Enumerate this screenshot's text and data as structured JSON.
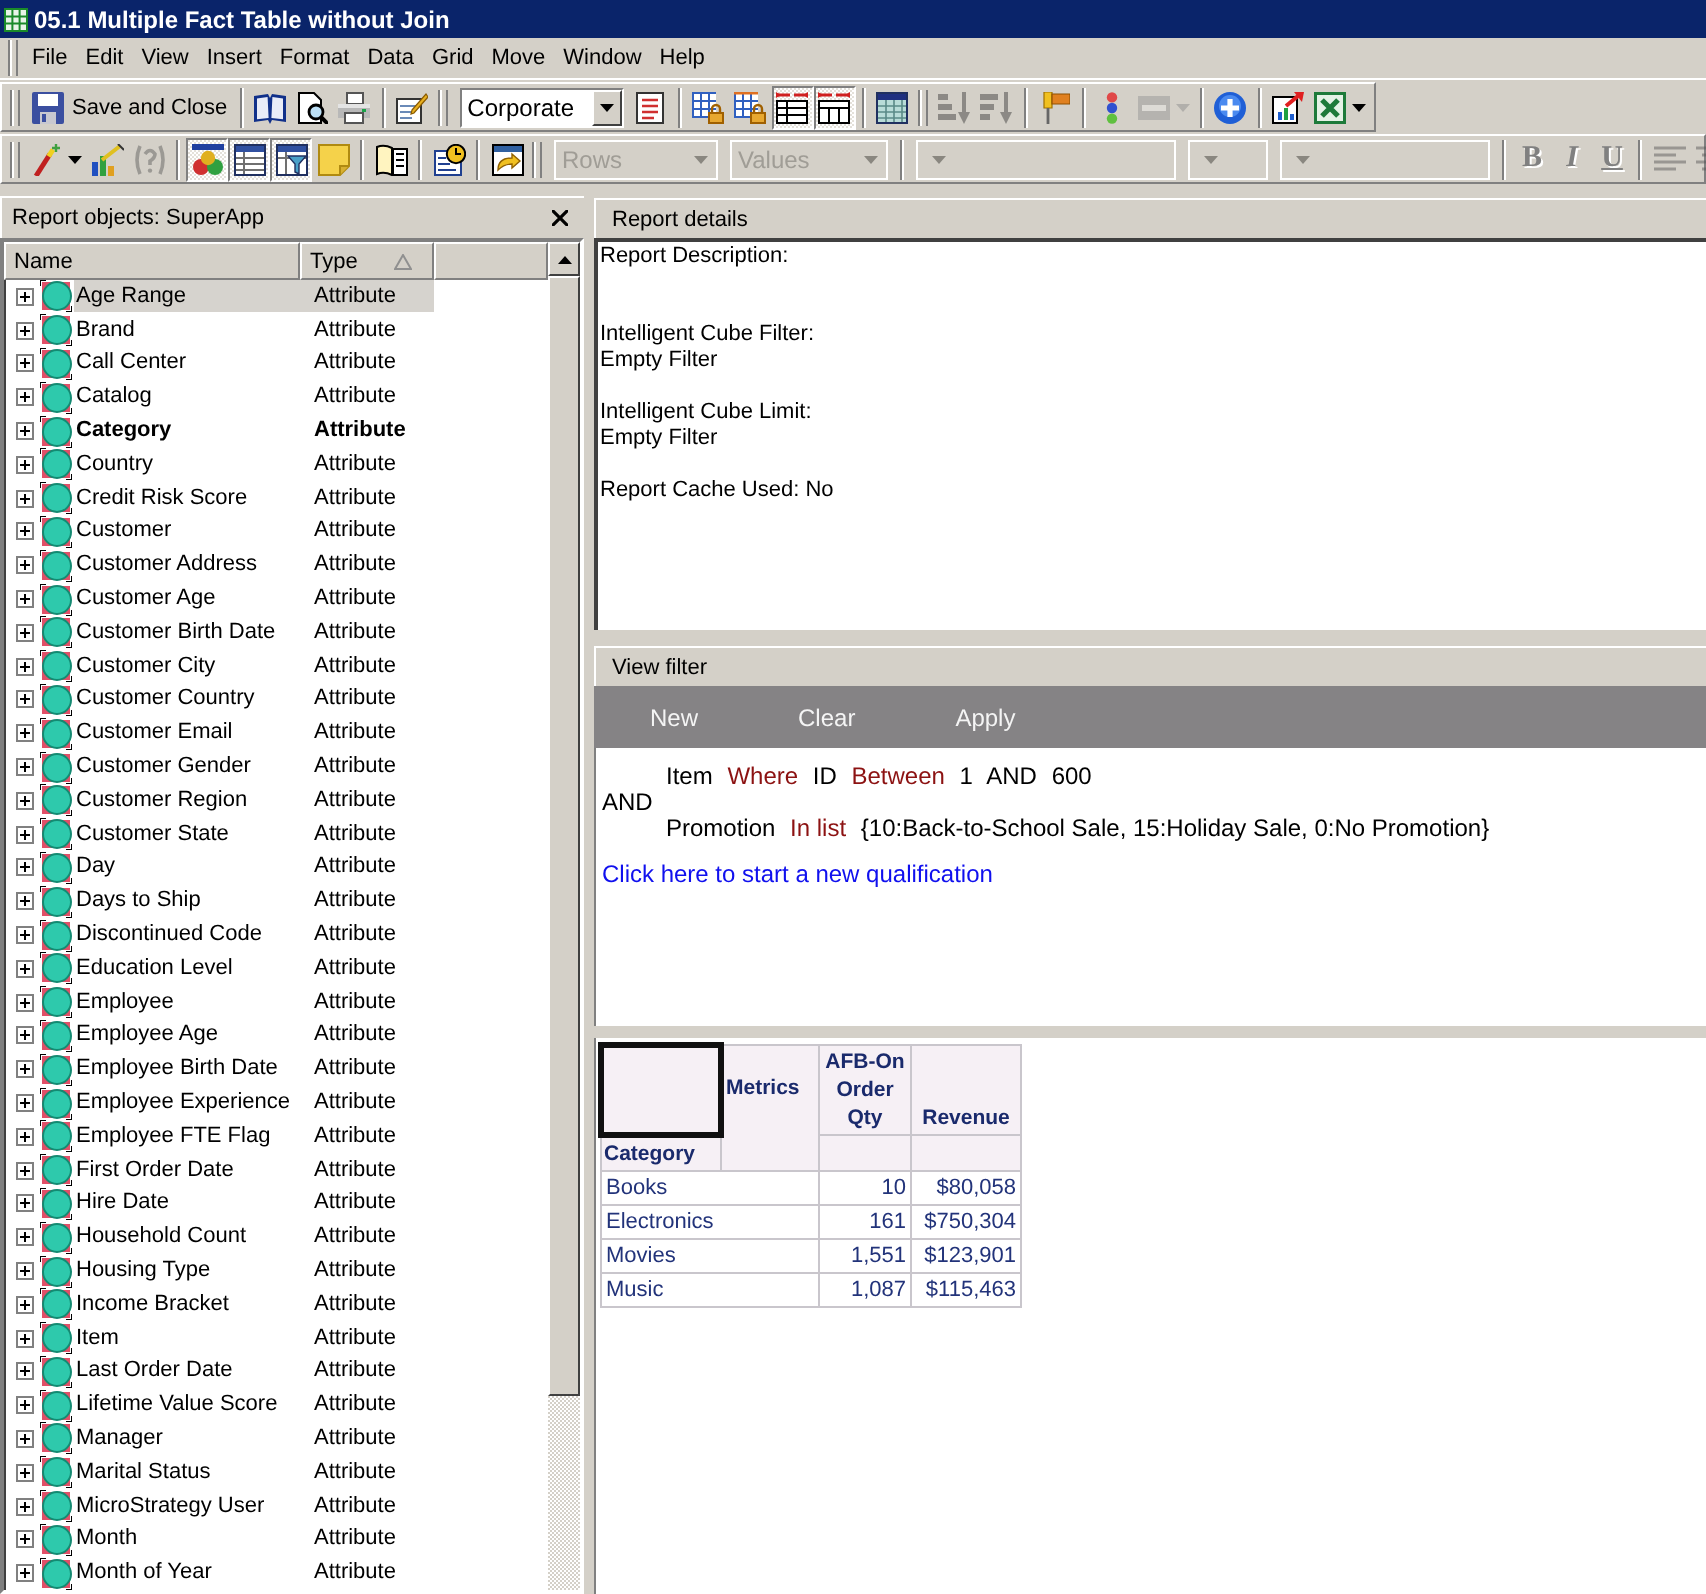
{
  "window": {
    "title": "05.1 Multiple Fact Table without Join"
  },
  "menu": [
    "File",
    "Edit",
    "View",
    "Insert",
    "Format",
    "Data",
    "Grid",
    "Move",
    "Window",
    "Help"
  ],
  "toolbar_1": {
    "save_button": {
      "label": "Save and Close"
    },
    "style_dropdown": {
      "value": "Corporate"
    },
    "buttons": [
      {
        "pressed": false,
        "disabled": false
      },
      {
        "pressed": false,
        "disabled": false
      },
      {
        "pressed": false,
        "disabled": false
      },
      {
        "pressed": false,
        "disabled": false
      },
      {
        "pressed": false,
        "disabled": false
      },
      {
        "pressed": false,
        "disabled": false
      },
      {
        "pressed": false,
        "disabled": false
      },
      {
        "pressed": true,
        "disabled": false
      },
      {
        "pressed": true,
        "disabled": false
      },
      {
        "pressed": false,
        "disabled": false
      },
      {
        "pressed": false,
        "disabled": true
      },
      {
        "pressed": false,
        "disabled": true
      },
      {
        "pressed": false,
        "disabled": false
      },
      {
        "pressed": false,
        "disabled": false
      },
      {
        "pressed": false,
        "disabled": true
      },
      {
        "pressed": false,
        "disabled": false
      },
      {
        "pressed": false,
        "disabled": false
      },
      {
        "pressed": false,
        "disabled": false
      }
    ]
  },
  "toolbar_2": {
    "buttons": [
      {
        "pressed": false,
        "disabled": false
      },
      {
        "pressed": false,
        "disabled": false
      },
      {
        "pressed": false,
        "disabled": true
      },
      {
        "pressed": true,
        "disabled": false
      },
      {
        "pressed": true,
        "disabled": false
      },
      {
        "pressed": true,
        "disabled": false
      },
      {
        "pressed": false,
        "disabled": false
      },
      {
        "pressed": false,
        "disabled": false
      },
      {
        "pressed": false,
        "disabled": false
      },
      {
        "pressed": false,
        "disabled": false
      },
      {
        "pressed": false,
        "disabled": true
      },
      {
        "pressed": false,
        "disabled": true
      }
    ],
    "pivot_dropdowns": [
      {
        "value": "Rows",
        "disabled": true
      },
      {
        "value": "Values",
        "disabled": true
      }
    ],
    "format_dropdowns": [
      {
        "disabled": true
      },
      {
        "disabled": true
      },
      {
        "disabled": true
      }
    ],
    "text_style_buttons": [
      {
        "label": "B",
        "kind": "bold",
        "disabled": true
      },
      {
        "label": "I",
        "kind": "italic",
        "disabled": true
      },
      {
        "label": "U",
        "kind": "underline",
        "disabled": true
      }
    ]
  },
  "report_objects": {
    "title": "Report objects: SuperApp",
    "columns": [
      {
        "label": "Name",
        "sorted": false
      },
      {
        "label": "Type",
        "sorted": true
      }
    ],
    "rows": [
      {
        "name": "Age Range",
        "type": "Attribute",
        "selected": true,
        "in_report": false,
        "expanded": false
      },
      {
        "name": "Brand",
        "type": "Attribute",
        "selected": false,
        "in_report": false,
        "expanded": false
      },
      {
        "name": "Call Center",
        "type": "Attribute",
        "selected": false,
        "in_report": false,
        "expanded": false
      },
      {
        "name": "Catalog",
        "type": "Attribute",
        "selected": false,
        "in_report": false,
        "expanded": false
      },
      {
        "name": "Category",
        "type": "Attribute",
        "selected": false,
        "in_report": true,
        "expanded": false
      },
      {
        "name": "Country",
        "type": "Attribute",
        "selected": false,
        "in_report": false,
        "expanded": false
      },
      {
        "name": "Credit Risk Score",
        "type": "Attribute",
        "selected": false,
        "in_report": false,
        "expanded": false
      },
      {
        "name": "Customer",
        "type": "Attribute",
        "selected": false,
        "in_report": false,
        "expanded": false
      },
      {
        "name": "Customer Address",
        "type": "Attribute",
        "selected": false,
        "in_report": false,
        "expanded": false
      },
      {
        "name": "Customer Age",
        "type": "Attribute",
        "selected": false,
        "in_report": false,
        "expanded": false
      },
      {
        "name": "Customer Birth Date",
        "type": "Attribute",
        "selected": false,
        "in_report": false,
        "expanded": false
      },
      {
        "name": "Customer City",
        "type": "Attribute",
        "selected": false,
        "in_report": false,
        "expanded": false
      },
      {
        "name": "Customer Country",
        "type": "Attribute",
        "selected": false,
        "in_report": false,
        "expanded": false
      },
      {
        "name": "Customer Email",
        "type": "Attribute",
        "selected": false,
        "in_report": false,
        "expanded": false
      },
      {
        "name": "Customer Gender",
        "type": "Attribute",
        "selected": false,
        "in_report": false,
        "expanded": false
      },
      {
        "name": "Customer Region",
        "type": "Attribute",
        "selected": false,
        "in_report": false,
        "expanded": false
      },
      {
        "name": "Customer State",
        "type": "Attribute",
        "selected": false,
        "in_report": false,
        "expanded": false
      },
      {
        "name": "Day",
        "type": "Attribute",
        "selected": false,
        "in_report": false,
        "expanded": false
      },
      {
        "name": "Days to Ship",
        "type": "Attribute",
        "selected": false,
        "in_report": false,
        "expanded": false
      },
      {
        "name": "Discontinued Code",
        "type": "Attribute",
        "selected": false,
        "in_report": false,
        "expanded": false
      },
      {
        "name": "Education Level",
        "type": "Attribute",
        "selected": false,
        "in_report": false,
        "expanded": false
      },
      {
        "name": "Employee",
        "type": "Attribute",
        "selected": false,
        "in_report": false,
        "expanded": false
      },
      {
        "name": "Employee Age",
        "type": "Attribute",
        "selected": false,
        "in_report": false,
        "expanded": false
      },
      {
        "name": "Employee Birth Date",
        "type": "Attribute",
        "selected": false,
        "in_report": false,
        "expanded": false
      },
      {
        "name": "Employee Experience",
        "type": "Attribute",
        "selected": false,
        "in_report": false,
        "expanded": false
      },
      {
        "name": "Employee FTE Flag",
        "type": "Attribute",
        "selected": false,
        "in_report": false,
        "expanded": false
      },
      {
        "name": "First Order Date",
        "type": "Attribute",
        "selected": false,
        "in_report": false,
        "expanded": false
      },
      {
        "name": "Hire Date",
        "type": "Attribute",
        "selected": false,
        "in_report": false,
        "expanded": false
      },
      {
        "name": "Household Count",
        "type": "Attribute",
        "selected": false,
        "in_report": false,
        "expanded": false
      },
      {
        "name": "Housing Type",
        "type": "Attribute",
        "selected": false,
        "in_report": false,
        "expanded": false
      },
      {
        "name": "Income Bracket",
        "type": "Attribute",
        "selected": false,
        "in_report": false,
        "expanded": false
      },
      {
        "name": "Item",
        "type": "Attribute",
        "selected": false,
        "in_report": false,
        "expanded": false
      },
      {
        "name": "Last Order Date",
        "type": "Attribute",
        "selected": false,
        "in_report": false,
        "expanded": false
      },
      {
        "name": "Lifetime Value Score",
        "type": "Attribute",
        "selected": false,
        "in_report": false,
        "expanded": false
      },
      {
        "name": "Manager",
        "type": "Attribute",
        "selected": false,
        "in_report": false,
        "expanded": false
      },
      {
        "name": "Marital Status",
        "type": "Attribute",
        "selected": false,
        "in_report": false,
        "expanded": false
      },
      {
        "name": "MicroStrategy User",
        "type": "Attribute",
        "selected": false,
        "in_report": false,
        "expanded": false
      },
      {
        "name": "Month",
        "type": "Attribute",
        "selected": false,
        "in_report": false,
        "expanded": false
      },
      {
        "name": "Month of Year",
        "type": "Attribute",
        "selected": false,
        "in_report": false,
        "expanded": false
      }
    ]
  },
  "report_details": {
    "title": "Report details",
    "description_label": "Report Description:",
    "sections": [
      {
        "label": "Intelligent Cube Filter:",
        "value": "Empty Filter"
      },
      {
        "label": "Intelligent Cube Limit:",
        "value": "Empty Filter"
      }
    ],
    "cache_status": "Report Cache Used: No"
  },
  "view_filter": {
    "title": "View filter",
    "actions": [
      "New",
      "Clear",
      "Apply"
    ],
    "operator": "AND",
    "conditions": [
      {
        "parts": [
          {
            "text": "Item",
            "kind": "plain"
          },
          {
            "text": "Where",
            "kind": "keyword"
          },
          {
            "text": "ID",
            "kind": "plain"
          },
          {
            "text": "Between",
            "kind": "keyword"
          },
          {
            "text": "1",
            "kind": "plain"
          },
          {
            "text": "AND",
            "kind": "plain"
          },
          {
            "text": "600",
            "kind": "plain"
          }
        ]
      },
      {
        "parts": [
          {
            "text": "Promotion",
            "kind": "plain"
          },
          {
            "text": "In list",
            "kind": "keyword"
          },
          {
            "text": "{10:Back-to-School Sale, 15:Holiday Sale, 0:No Promotion}",
            "kind": "plain"
          }
        ]
      }
    ],
    "new_qualification_link": "Click here to start a new qualification"
  },
  "grid": {
    "corner": {
      "selected": true
    },
    "metrics_label": "Metrics",
    "row_header": "Category",
    "columns": [
      "AFB-On Order Qty",
      "Revenue"
    ],
    "rows": [
      {
        "category": "Books",
        "values": [
          "10",
          "$80,058"
        ]
      },
      {
        "category": "Electronics",
        "values": [
          "161",
          "$750,304"
        ]
      },
      {
        "category": "Movies",
        "values": [
          "1,551",
          "$123,901"
        ]
      },
      {
        "category": "Music",
        "values": [
          "1,087",
          "$115,463"
        ]
      }
    ]
  }
}
